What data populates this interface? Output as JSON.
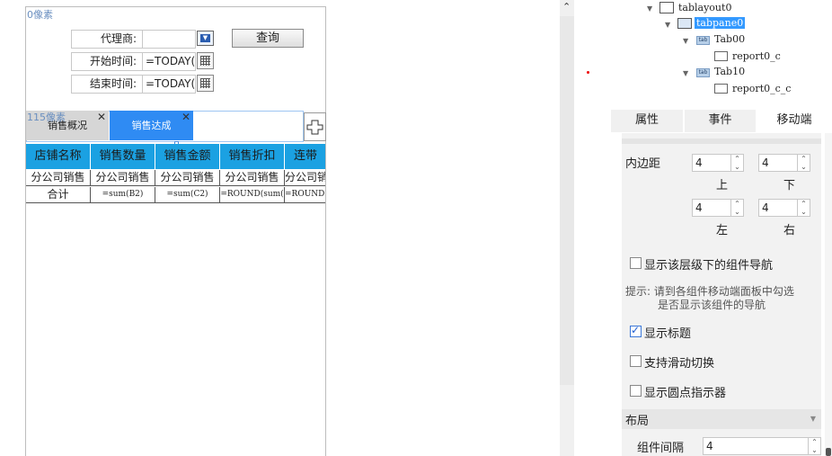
{
  "designer": {
    "top_px_label": "0像素",
    "tabs_px_label": "115像素",
    "params": {
      "agent_label": "代理商:",
      "start_label": "开始时间:",
      "start_value": "=TODAY(",
      "end_label": "结束时间:",
      "end_value": "=TODAY(",
      "query_button": "查询"
    },
    "tabs": [
      {
        "label": "销售概况",
        "close": "✕"
      },
      {
        "label": "销售达成",
        "close": "✕"
      }
    ],
    "add_tab_icon": "plus-icon",
    "table": {
      "headers": [
        "店铺名称",
        "销售数量",
        "销售金额",
        "销售折扣",
        "连带"
      ],
      "row1": [
        "分公司销售",
        "分公司销售",
        "分公司销售",
        "分公司销售",
        "分公司销"
      ],
      "row2": [
        "合计",
        "=sum(B2)",
        "=sum(C2)",
        "=ROUND(sum(",
        "=ROUND("
      ]
    }
  },
  "tree": {
    "items": [
      {
        "label": "tablayout0"
      },
      {
        "label": "tabpane0"
      },
      {
        "label": "Tab00"
      },
      {
        "label": "report0_c"
      },
      {
        "label": "Tab10"
      },
      {
        "label": "report0_c_c"
      }
    ],
    "tab_icon_text": "tab"
  },
  "panel": {
    "tabs": [
      "属性",
      "事件",
      "移动端"
    ],
    "active_tab": "移动端",
    "padding": {
      "label": "内边距",
      "top": "4",
      "bottom": "4",
      "left": "4",
      "right": "4",
      "top_label": "上",
      "bottom_label": "下",
      "left_label": "左",
      "right_label": "右"
    },
    "show_nav": {
      "label": "显示该层级下的组件导航",
      "checked": false
    },
    "hint_line1": "提示: 请到各组件移动端面板中勾选",
    "hint_line2": "是否显示该组件的导航",
    "show_title": {
      "label": "显示标题",
      "checked": true
    },
    "swipe": {
      "label": "支持滑动切换",
      "checked": false
    },
    "dots": {
      "label": "显示圆点指示器",
      "checked": false
    },
    "layout_section": "布局",
    "gap": {
      "label": "组件间隔",
      "value": "4"
    }
  },
  "colors": {
    "table_header": "#1ba1e2",
    "active_tab": "#2f8bf3",
    "tree_selected": "#3399ff"
  }
}
